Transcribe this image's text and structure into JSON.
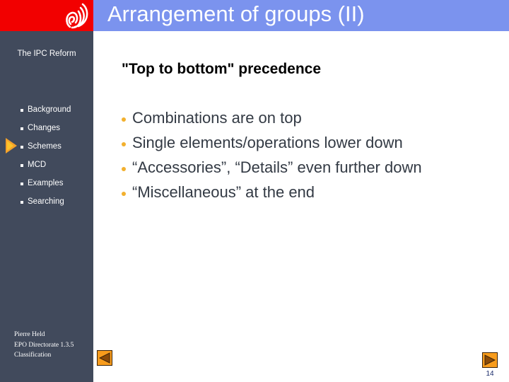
{
  "header": {
    "logo_icon": "epo-logo-icon",
    "title": "Arrangement of groups (II)"
  },
  "sidebar": {
    "section_label": "The IPC Reform",
    "items": [
      {
        "label": "Background",
        "current": false
      },
      {
        "label": "Changes",
        "current": false
      },
      {
        "label": "Schemes",
        "current": true
      },
      {
        "label": "MCD",
        "current": false
      },
      {
        "label": "Examples",
        "current": false
      },
      {
        "label": "Searching",
        "current": false
      }
    ],
    "footer": {
      "author": "Pierre Held",
      "department": "EPO Directorate 1.3.5",
      "unit": "Classification"
    }
  },
  "main": {
    "subtitle": "\"Top to bottom\" precedence",
    "bullets": [
      "Combinations are on top",
      "Single elements/operations lower down",
      "“Accessories”, “Details” even further down",
      "“Miscellaneous” at the end"
    ]
  },
  "navigation": {
    "prev_icon": "triangle-left-icon",
    "next_icon": "triangle-right-icon",
    "page_number": "14"
  },
  "colors": {
    "logo_red": "#f20000",
    "title_bar": "#7b93ee",
    "sidebar": "#414a5c",
    "bullet_accent": "#f2b02e",
    "nav_button": "#f89c1c"
  }
}
